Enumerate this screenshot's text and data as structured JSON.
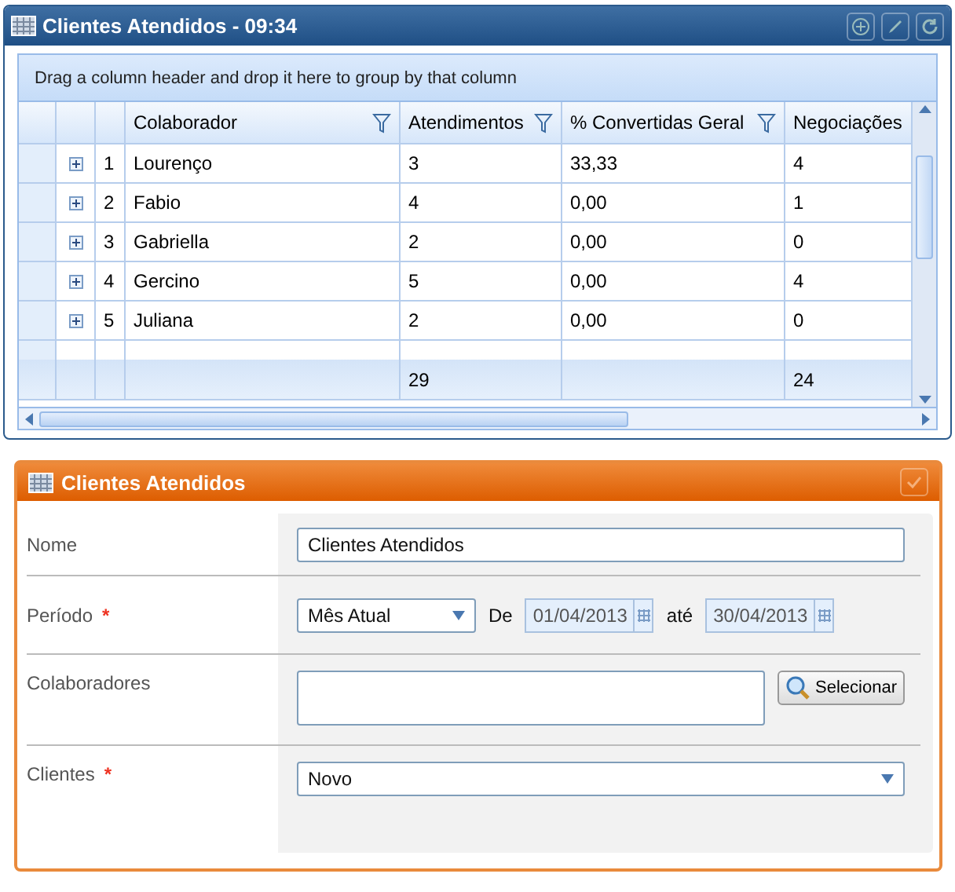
{
  "grid_window": {
    "title": "Clientes Atendidos - 09:34",
    "group_panel": "Drag a column header and drop it here to group by that column",
    "columns": [
      {
        "label": "Colaborador",
        "filter": true
      },
      {
        "label": "Atendimentos",
        "filter": true
      },
      {
        "label": "% Convertidas Geral",
        "filter": true
      },
      {
        "label": "Negociações",
        "filter": false
      }
    ],
    "totals": {
      "atendimentos": "29",
      "negociacoes": "24"
    },
    "rows": [
      {
        "number": "1",
        "cells": [
          "Lourenço",
          "3",
          "33,33",
          "4"
        ]
      },
      {
        "number": "2",
        "cells": [
          "Fabio",
          "4",
          "0,00",
          "1"
        ]
      },
      {
        "number": "3",
        "cells": [
          "Gabriella",
          "2",
          "0,00",
          "0"
        ]
      },
      {
        "number": "4",
        "cells": [
          "Gercino",
          "5",
          "0,00",
          "4"
        ]
      },
      {
        "number": "5",
        "cells": [
          "Juliana",
          "2",
          "0,00",
          "0"
        ]
      }
    ]
  },
  "form_window": {
    "title": "Clientes Atendidos",
    "fields": [
      {
        "kind": "text",
        "label": "Nome",
        "value": "Clientes Atendidos"
      },
      {
        "kind": "period",
        "label": "Período",
        "required_mark": "*",
        "select": "Mês Atual",
        "from_label": "De",
        "from": "01/04/2013",
        "to_label": "até",
        "to": "30/04/2013"
      },
      {
        "kind": "picker",
        "label": "Colaboradores",
        "button": "Selecionar"
      },
      {
        "kind": "select",
        "label": "Clientes",
        "required_mark": "*",
        "value": "Novo"
      }
    ]
  }
}
